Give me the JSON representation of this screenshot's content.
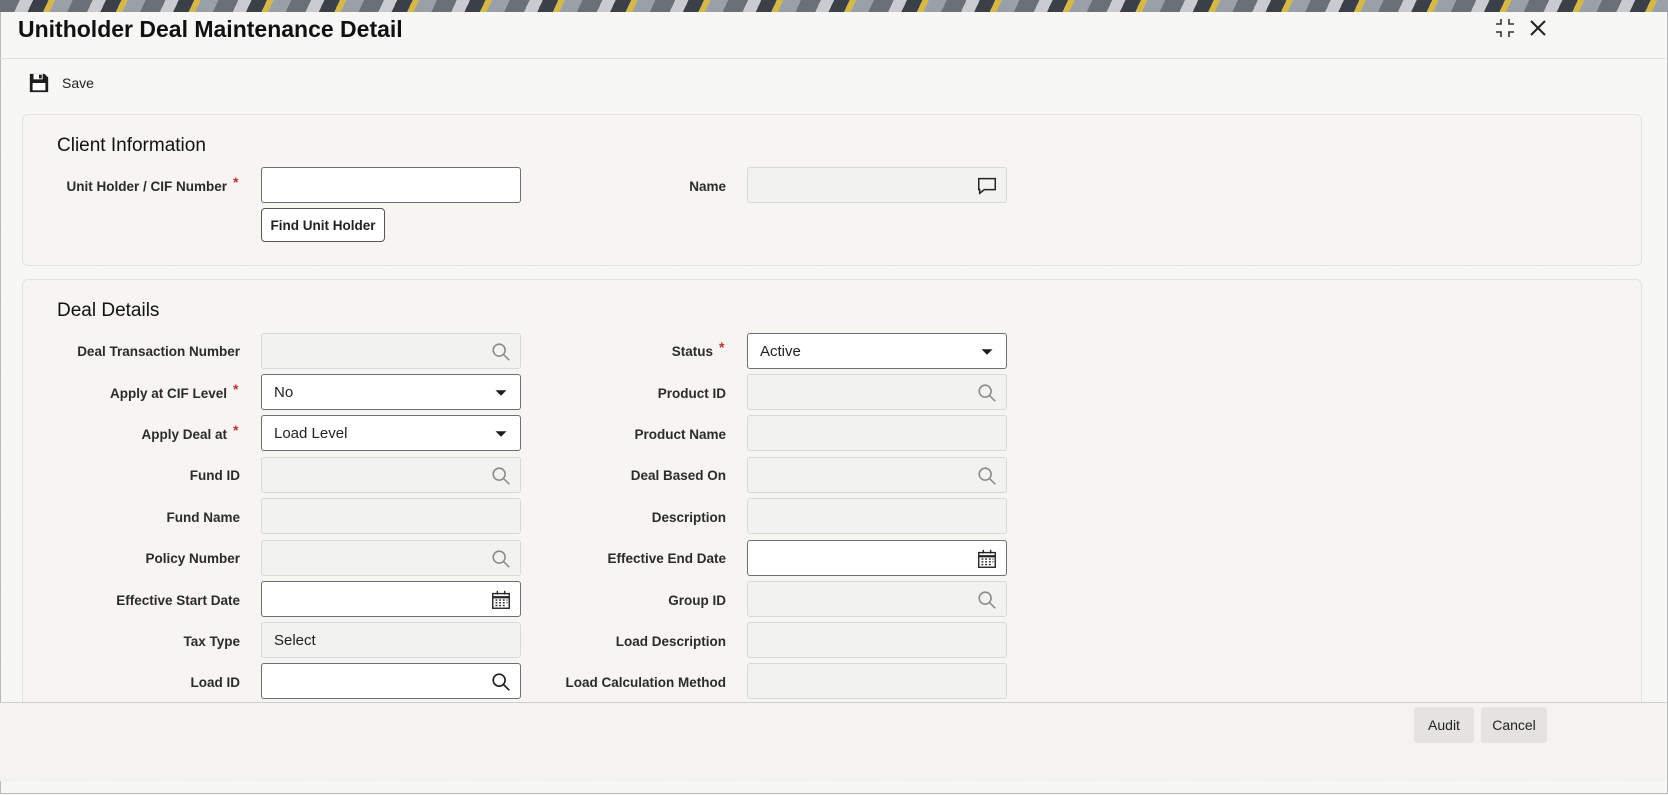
{
  "window": {
    "title": "Unitholder Deal Maintenance Detail"
  },
  "toolbar": {
    "save_label": "Save"
  },
  "client_info": {
    "heading": "Client Information",
    "unit_holder_label": "Unit Holder / CIF Number",
    "unit_holder_value": "",
    "find_button": "Find Unit Holder",
    "name_label": "Name",
    "name_value": ""
  },
  "deal_details": {
    "heading": "Deal Details",
    "required_marker": "*",
    "left": [
      {
        "label": "Deal Transaction Number",
        "value": "",
        "required": false
      },
      {
        "label": "Apply at CIF Level",
        "value": "No",
        "required": true
      },
      {
        "label": "Apply Deal at",
        "value": "Load Level",
        "required": true
      },
      {
        "label": "Fund ID",
        "value": "",
        "required": false
      },
      {
        "label": "Fund Name",
        "value": "",
        "required": false
      },
      {
        "label": "Policy Number",
        "value": "",
        "required": false
      },
      {
        "label": "Effective Start Date",
        "value": "",
        "required": false
      },
      {
        "label": "Tax Type",
        "value": "Select",
        "required": false
      },
      {
        "label": "Load ID",
        "value": "",
        "required": false
      }
    ],
    "right": [
      {
        "label": "Status",
        "value": "Active",
        "required": true
      },
      {
        "label": "Product ID",
        "value": "",
        "required": false
      },
      {
        "label": "Product Name",
        "value": "",
        "required": false
      },
      {
        "label": "Deal Based On",
        "value": "",
        "required": false
      },
      {
        "label": "Description",
        "value": "",
        "required": false
      },
      {
        "label": "Effective End Date",
        "value": "",
        "required": false
      },
      {
        "label": "Group ID",
        "value": "",
        "required": false
      },
      {
        "label": "Load Description",
        "value": "",
        "required": false
      },
      {
        "label": "Load Calculation Method",
        "value": "",
        "required": false
      }
    ]
  },
  "footer": {
    "audit_label": "Audit",
    "cancel_label": "Cancel"
  },
  "icons": {
    "save": "floppy-disk-icon",
    "minimize": "collapse-icon",
    "close": "close-icon",
    "search": "search-icon",
    "calendar": "calendar-icon",
    "dropdown": "caret-down-icon",
    "chat": "chat-bubble-icon"
  }
}
